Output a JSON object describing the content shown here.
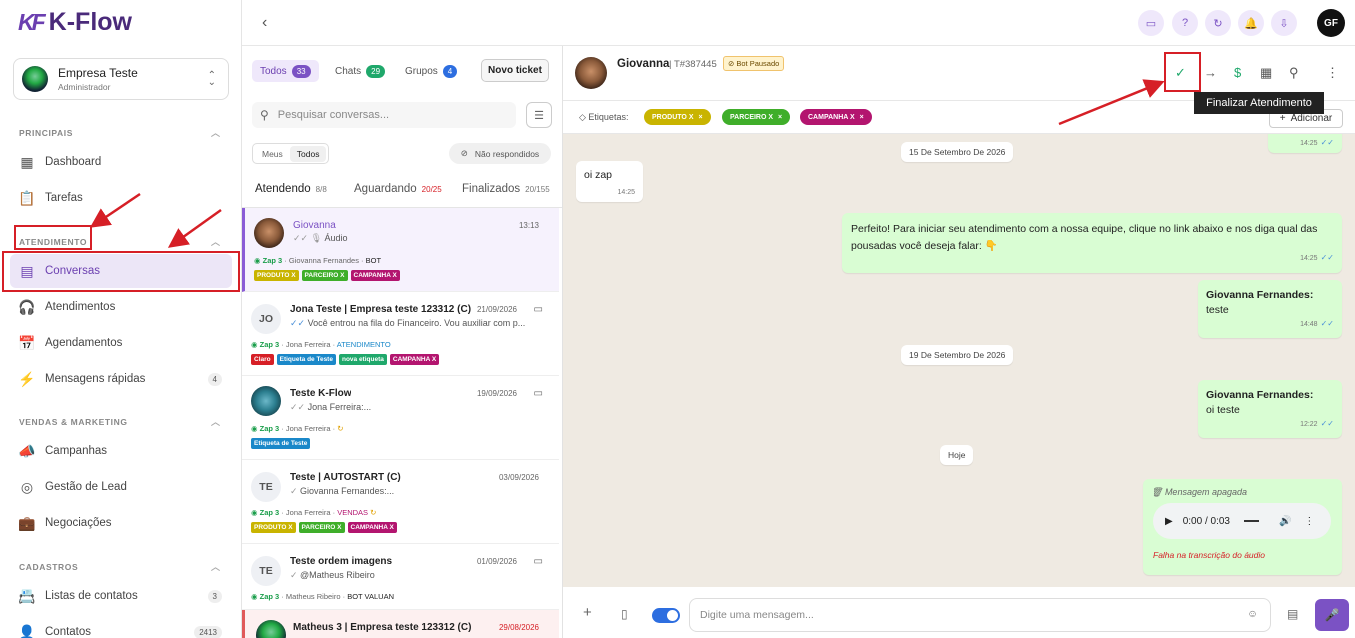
{
  "brand": {
    "logo_mark": "KF",
    "name": "K-Flow"
  },
  "company": {
    "name": "Empresa Teste",
    "role": "Administrador"
  },
  "sidebar": {
    "sections": [
      {
        "label": "PRINCIPAIS"
      },
      {
        "label": "ATENDIMENTO"
      },
      {
        "label": "VENDAS & MARKETING"
      },
      {
        "label": "CADASTROS"
      }
    ],
    "items": [
      {
        "label": "Dashboard",
        "icon": "grid-icon"
      },
      {
        "label": "Tarefas",
        "icon": "clipboard-icon"
      },
      {
        "label": "Conversas",
        "icon": "chat-icon",
        "active": true
      },
      {
        "label": "Atendimentos",
        "icon": "headset-icon"
      },
      {
        "label": "Agendamentos",
        "icon": "calendar-icon"
      },
      {
        "label": "Mensagens rápidas",
        "icon": "bolt-icon",
        "count": "4"
      },
      {
        "label": "Campanhas",
        "icon": "megaphone-icon"
      },
      {
        "label": "Gestão de Lead",
        "icon": "target-icon"
      },
      {
        "label": "Negociações",
        "icon": "briefcase-icon"
      },
      {
        "label": "Listas de contatos",
        "icon": "contacts-icon",
        "count": "3"
      },
      {
        "label": "Contatos",
        "icon": "contact-icon",
        "count": "2413"
      }
    ]
  },
  "topbar": {
    "user_initials": "GF"
  },
  "list": {
    "filters": [
      {
        "label": "Todos",
        "count": "33"
      },
      {
        "label": "Chats",
        "count": "29"
      },
      {
        "label": "Grupos",
        "count": "4"
      }
    ],
    "new_ticket": "Novo ticket",
    "search_placeholder": "Pesquisar conversas...",
    "seg": [
      "Meus",
      "Todos"
    ],
    "not_answered": "Não respondidos",
    "status_tabs": [
      {
        "label": "Atendendo",
        "count": "8/8"
      },
      {
        "label": "Aguardando",
        "count": "20/25"
      },
      {
        "label": "Finalizados",
        "count": "20/155"
      }
    ],
    "conversations": [
      {
        "name": "Giovanna",
        "date": "13:13",
        "preview": "Áudio",
        "channel": "Zap 3",
        "agent": "Giovanna Fernandes",
        "status": "BOT",
        "tags": [
          "PRODUTO X",
          "PARCEIRO X",
          "CAMPANHA X"
        ]
      },
      {
        "initials": "JO",
        "name": "Jona Teste | Empresa teste 123312 (C)",
        "date": "21/09/2026",
        "preview": "Você entrou na fila do Financeiro. Vou auxiliar com p...",
        "channel": "Zap 3",
        "agent": "Jona Ferreira",
        "status": "ATENDIMENTO",
        "tags": [
          "Claro",
          "Etiqueta de Teste",
          "nova etiqueta",
          "CAMPANHA X"
        ]
      },
      {
        "name": "Teste K-Flow",
        "date": "19/09/2026",
        "preview": "Jona Ferreira:...",
        "channel": "Zap 3",
        "agent": "Jona Ferreira",
        "tags": [
          "Etiqueta de Teste"
        ]
      },
      {
        "initials": "TE",
        "name": "Teste | AUTOSTART (C)",
        "date": "03/09/2026",
        "preview": "Giovanna Fernandes:...",
        "channel": "Zap 3",
        "agent": "Jona Ferreira",
        "status": "VENDAS",
        "tags": [
          "PRODUTO X",
          "PARCEIRO X",
          "CAMPANHA X"
        ]
      },
      {
        "initials": "TE",
        "name": "Teste ordem imagens",
        "date": "01/09/2026",
        "preview": "@Matheus Ribeiro",
        "channel": "Zap 3",
        "agent": "Matheus Ribeiro",
        "status": "BOT VALUAN"
      },
      {
        "name": "Matheus 3 | Empresa teste 123312 (C)",
        "date": "29/08/2026"
      }
    ]
  },
  "chat": {
    "contact_name": "Giovanna",
    "ticket_id": "T#387445",
    "bot_status": "Bot Pausado",
    "tooltip": "Finalizar Atendimento",
    "labels_title": "Etiquetas:",
    "labels": [
      "PRODUTO X",
      "PARCEIRO X",
      "CAMPANHA X"
    ],
    "add_label": "Adicionar",
    "messages": [
      {
        "time": "14:25"
      },
      {
        "date": "15 De Setembro De 2026"
      },
      {
        "text": "oi zap",
        "time": "14:25"
      },
      {
        "text": "Perfeito! Para iniciar seu atendimento com a nossa equipe, clique no link abaixo e nos diga qual das pousadas você deseja falar: 👇",
        "time": "14:25"
      },
      {
        "sender": "Giovanna Fernandes:",
        "text": "teste",
        "time": "14:48"
      },
      {
        "date": "19 De Setembro De 2026"
      },
      {
        "sender": "Giovanna Fernandes:",
        "text": "oi teste",
        "time": "12:22"
      },
      {
        "date": "Hoje"
      },
      {
        "deleted": "Mensagem apagada",
        "audio_time": "0:00 / 0:03",
        "error": "Falha na transcrição do áudio"
      }
    ],
    "input_placeholder": "Digite uma mensagem..."
  },
  "colors": {
    "accent": "#6b3fb0",
    "annotation": "#d61f26",
    "tag_produto": "#c9b400",
    "tag_parceiro": "#3fae2a",
    "tag_campanha": "#b3156f",
    "tag_claro": "#d61f26",
    "tag_etiqueta_teste": "#1a88c9",
    "tag_nova": "#1fa86b"
  }
}
